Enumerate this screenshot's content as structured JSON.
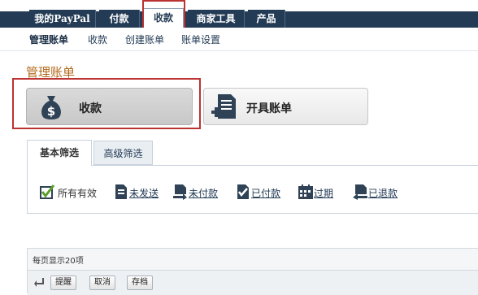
{
  "top_tabs": [
    {
      "label": "我的PayPal"
    },
    {
      "label": "付款"
    },
    {
      "label": "收款"
    },
    {
      "label": "商家工具"
    },
    {
      "label": "产品"
    }
  ],
  "subnav": [
    {
      "label": "管理账单"
    },
    {
      "label": "收款"
    },
    {
      "label": "创建账单"
    },
    {
      "label": "账单设置"
    }
  ],
  "page_title": "管理账单",
  "big_buttons": {
    "receive": {
      "label": "收款",
      "icon": "money-bag-icon"
    },
    "invoice": {
      "label": "开具账单",
      "icon": "document-add-icon"
    }
  },
  "filter_tabs": [
    {
      "label": "基本筛选"
    },
    {
      "label": "高级筛选"
    }
  ],
  "filters": [
    {
      "label": "所有有效",
      "icon": "checkmark-list-icon"
    },
    {
      "label": "未发送",
      "icon": "document-icon"
    },
    {
      "label": "未付款",
      "icon": "document-arrow-icon"
    },
    {
      "label": "已付款",
      "icon": "document-check-icon"
    },
    {
      "label": "过期",
      "icon": "calendar-icon"
    },
    {
      "label": "已退款",
      "icon": "refund-icon"
    }
  ],
  "table": {
    "per_page_text": "每页显示20项",
    "actions": [
      {
        "label": "提醒"
      },
      {
        "label": "取消"
      },
      {
        "label": "存档"
      }
    ]
  },
  "colors": {
    "nav_dark": "#233b55",
    "title_orange": "#b26a1b",
    "highlight_red": "#b33333"
  }
}
